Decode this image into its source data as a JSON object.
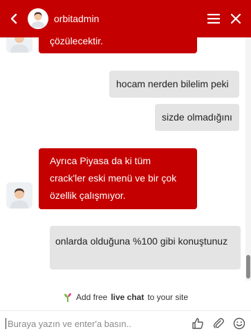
{
  "header": {
    "agent_name": "orbitadmin",
    "back_icon": "chevron-left-icon",
    "menu_icon": "hamburger-menu-icon",
    "close_icon": "close-icon",
    "background_color": "#c50000"
  },
  "messages": [
    {
      "from": "agent",
      "text": "çözülecektir."
    },
    {
      "from": "user",
      "text": "hocam nerden bilelim peki"
    },
    {
      "from": "user",
      "text": "sizde olmadığını"
    },
    {
      "from": "agent",
      "text": "Ayrıca Piyasa da ki tüm crack'ler eski menü ve bir çok özellik çalışmıyor."
    },
    {
      "from": "user",
      "text": "onlarda olduğuna %100 gibi konuştunuz"
    }
  ],
  "branding": {
    "prefix": "Add free",
    "highlight": "live chat",
    "suffix": "to your site"
  },
  "composer": {
    "placeholder": "Buraya yazın ve enter'a basın..",
    "value": ""
  },
  "colors": {
    "agent_bubble": "#c50000",
    "user_bubble": "#e4e4e4"
  }
}
